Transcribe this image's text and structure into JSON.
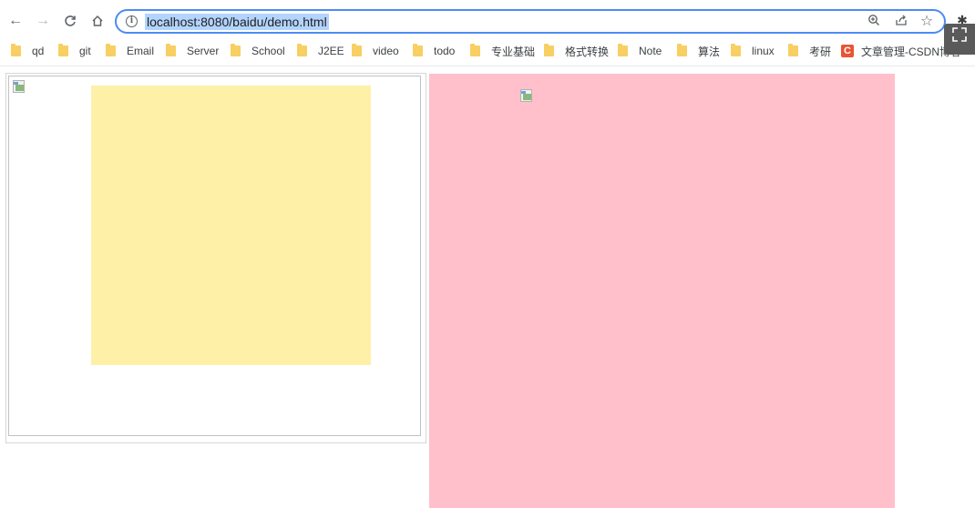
{
  "browser": {
    "url": "localhost:8080/baidu/demo.html",
    "nav": {
      "back": "←",
      "forward": "→",
      "reload": "C",
      "home": "⌂"
    },
    "icons": {
      "info": "i",
      "zoom": "⊕",
      "share": "⇪",
      "star": "☆",
      "extension": "✱",
      "expand": "⛶"
    }
  },
  "bookmarks": [
    {
      "label": "qd",
      "icon": "folder-icon"
    },
    {
      "label": "git",
      "icon": "folder-icon"
    },
    {
      "label": "Email",
      "icon": "folder-icon"
    },
    {
      "label": "Server",
      "icon": "folder-icon"
    },
    {
      "label": "School",
      "icon": "folder-icon"
    },
    {
      "label": "J2EE",
      "icon": "folder-icon"
    },
    {
      "label": "video",
      "icon": "folder-icon"
    },
    {
      "label": "todo",
      "icon": "folder-icon"
    },
    {
      "label": "专业基础",
      "icon": "folder-icon"
    },
    {
      "label": "格式转换",
      "icon": "folder-icon"
    },
    {
      "label": "Note",
      "icon": "folder-icon"
    },
    {
      "label": "算法",
      "icon": "folder-icon"
    },
    {
      "label": "linux",
      "icon": "folder-icon"
    },
    {
      "label": "考研",
      "icon": "folder-icon"
    },
    {
      "label": "文章管理-CSDN博客",
      "icon": "csdn-logo",
      "logo_letter": "C"
    }
  ],
  "page": {
    "yellow_color": "#fff0a8",
    "pink_color": "#ffc0cb"
  }
}
